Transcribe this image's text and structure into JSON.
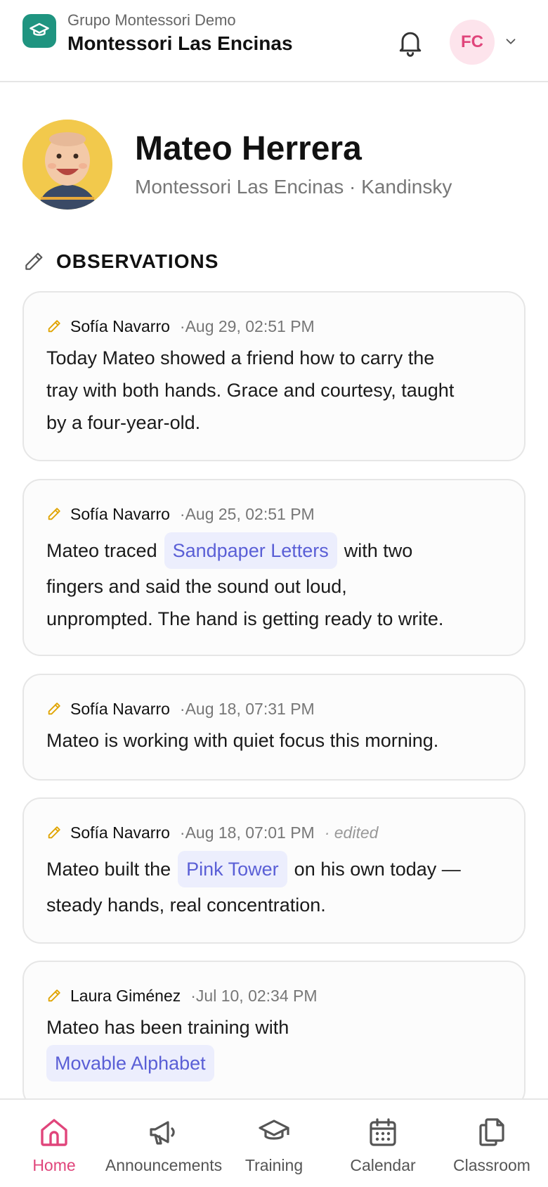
{
  "header": {
    "org_name": "Grupo Montessori Demo",
    "school_name": "Montessori Las Encinas",
    "user_initials": "FC"
  },
  "profile": {
    "name": "Mateo Herrera",
    "subtitle": "Montessori Las Encinas · Kandinsky"
  },
  "section": {
    "title": "OBSERVATIONS"
  },
  "observations": [
    {
      "author": "Sofía Navarro",
      "date": "·Aug 29, 02:51 PM",
      "lines": [
        "Today Mateo showed a friend how to carry the",
        "tray with both hands. Grace and courtesy, taught",
        "by a four-year-old."
      ]
    },
    {
      "author": "Sofía Navarro",
      "date": "·Aug 25, 02:51 PM",
      "pre": "Mateo traced",
      "chip": "Sandpaper Letters",
      "post": "with two",
      "lines": [
        "fingers and said the sound out loud,",
        "unprompted. The hand is getting ready to write."
      ]
    },
    {
      "author": "Sofía Navarro",
      "date": "·Aug 18, 07:31 PM",
      "lines": [
        "Mateo is working with quiet focus this morning."
      ]
    },
    {
      "author": "Sofía Navarro",
      "date": "·Aug 18, 07:01 PM",
      "edited": "· edited",
      "pre": "Mateo built the",
      "chip": "Pink Tower",
      "post": "on his own today —",
      "lines": [
        "steady hands, real concentration."
      ]
    },
    {
      "author": "Laura Giménez",
      "date": "·Jul 10, 02:34 PM",
      "line1": "Mateo has been training with",
      "chip": "Movable Alphabet"
    }
  ],
  "nav": {
    "items": [
      {
        "label": "Home",
        "icon": "home-icon",
        "active": true
      },
      {
        "label": "Announcements",
        "icon": "megaphone-icon"
      },
      {
        "label": "Training",
        "icon": "graduation-cap-icon"
      },
      {
        "label": "Calendar",
        "icon": "calendar-icon"
      },
      {
        "label": "Classroom",
        "icon": "copy-icon"
      }
    ]
  },
  "colors": {
    "brand_teal": "#1f9480",
    "accent_pink": "#e0457b",
    "chip_bg": "#eceefd",
    "chip_text": "#5a5fd6",
    "pencil_yellow": "#e0a400"
  }
}
